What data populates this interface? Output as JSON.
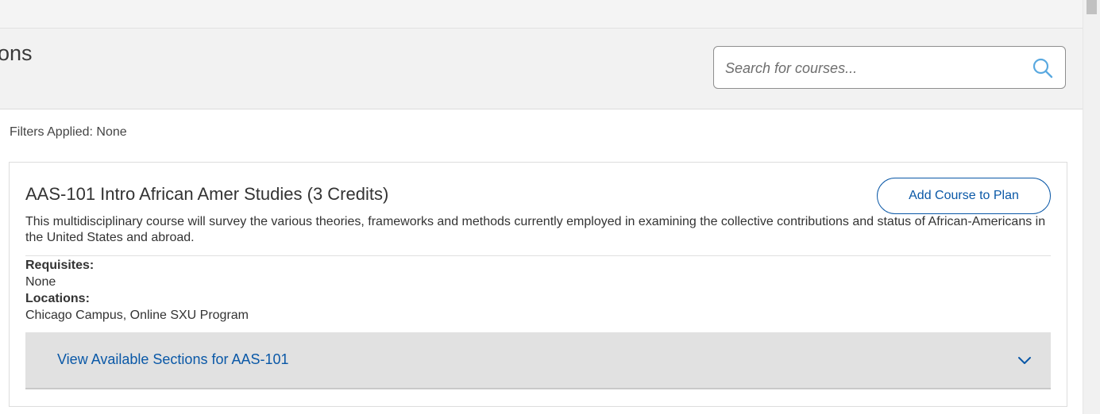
{
  "header": {
    "page_title": "ctions",
    "search": {
      "value": "",
      "placeholder": "Search for courses..."
    }
  },
  "filters": {
    "text": "Filters Applied: None"
  },
  "course": {
    "title": "AAS-101 Intro African Amer Studies (3 Credits)",
    "add_button_label": "Add Course to Plan",
    "description": "This multidisciplinary course will survey the various theories, frameworks and methods currently employed in examining the collective contributions and status of African-Americans in the United States and abroad.",
    "requisites_label": "Requisites:",
    "requisites_value": "None",
    "locations_label": "Locations:",
    "locations_value": "Chicago Campus, Online SXU Program",
    "sections_toggle_label": "View Available Sections for AAS-101"
  },
  "icons": {
    "search": "search-icon",
    "chevron": "chevron-down-icon"
  },
  "colors": {
    "accent": "#0a58a7",
    "search_icon": "#5aa9e0",
    "header_bg": "#f2f2f2",
    "sections_bg": "#e1e1e1"
  }
}
